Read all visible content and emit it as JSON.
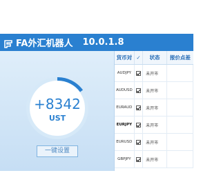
{
  "window": {
    "title": "FA外汇机器人",
    "version": "10.0.1.8"
  },
  "balance": {
    "amount": "+8342",
    "unit": "UST"
  },
  "buttons": {
    "setup_label": "一键设置"
  },
  "table": {
    "headers": {
      "symbol": "货币对",
      "check": "✓",
      "status": "状态",
      "price": "报价点差"
    },
    "rows": [
      {
        "symbol": "AUDJPY",
        "status": "未开市",
        "price": "",
        "bold": false
      },
      {
        "symbol": "AUDUSD",
        "status": "未开市",
        "price": "",
        "bold": false
      },
      {
        "symbol": "EURAUD",
        "status": "未开市",
        "price": "",
        "bold": false
      },
      {
        "symbol": "EURJPY",
        "status": "未开市",
        "price": "",
        "bold": true
      },
      {
        "symbol": "EURUSD",
        "status": "未开市",
        "price": "",
        "bold": false
      },
      {
        "symbol": "GBPJPY",
        "status": "未开市",
        "price": "",
        "bold": false
      }
    ]
  },
  "colors": {
    "titlebar": "#2a80d0",
    "accent": "#2a80d0",
    "panel_bg": "#d4e7f7"
  }
}
